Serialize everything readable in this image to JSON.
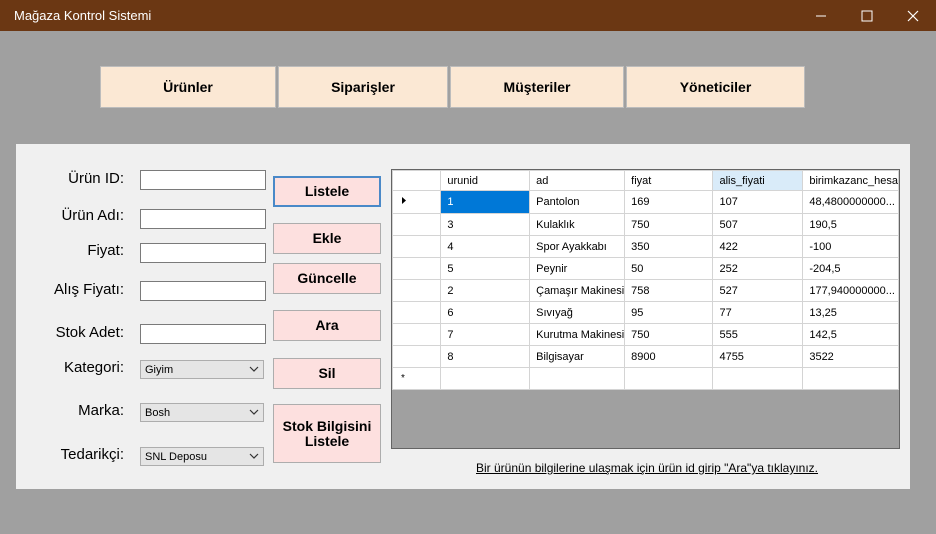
{
  "window": {
    "title": "Mağaza Kontrol Sistemi"
  },
  "nav": [
    {
      "label": "Ürünler"
    },
    {
      "label": "Siparişler"
    },
    {
      "label": "Müşteriler"
    },
    {
      "label": "Yöneticiler"
    }
  ],
  "form": {
    "urun_id_label": "Ürün ID:",
    "urun_adi_label": "Ürün Adı:",
    "fiyat_label": "Fiyat:",
    "alis_fiyati_label": "Alış Fiyatı:",
    "stok_adet_label": "Stok Adet:",
    "kategori_label": "Kategori:",
    "marka_label": "Marka:",
    "tedarikci_label": "Tedarikçi:",
    "kategori_value": "Giyim",
    "marka_value": "Bosh",
    "tedarikci_value": "SNL Deposu"
  },
  "actions": {
    "listele": "Listele",
    "ekle": "Ekle",
    "guncelle": "Güncelle",
    "ara": "Ara",
    "sil": "Sil",
    "stok": "Stok Bilgisini Listele"
  },
  "grid": {
    "columns": [
      "urunid",
      "ad",
      "fiyat",
      "alis_fiyati",
      "birimkazanc_hesa"
    ],
    "rows": [
      [
        "1",
        "Pantolon",
        "169",
        "107",
        "48,4800000000..."
      ],
      [
        "3",
        "Kulaklık",
        "750",
        "507",
        "190,5"
      ],
      [
        "4",
        "Spor Ayakkabı",
        "350",
        "422",
        "-100"
      ],
      [
        "5",
        "Peynir",
        "50",
        "252",
        "-204,5"
      ],
      [
        "2",
        "Çamaşır Makinesi",
        "758",
        "527",
        "177,940000000..."
      ],
      [
        "6",
        "Sıvıyağ",
        "95",
        "77",
        "13,25"
      ],
      [
        "7",
        "Kurutma Makinesi",
        "750",
        "555",
        "142,5"
      ],
      [
        "8",
        "Bilgisayar",
        "8900",
        "4755",
        "3522"
      ]
    ],
    "new_row_marker": "*"
  },
  "footer_note": "Bir ürünün bilgilerine ulaşmak için ürün id girip \"Ara\"ya tıklayınız.",
  "icons": {
    "current_row": "triangle-right-icon",
    "combo": "chevron-down-icon"
  }
}
